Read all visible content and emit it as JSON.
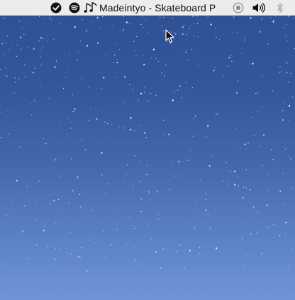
{
  "menubar": {
    "icons": {
      "checkmark": "checkmark-circle-icon",
      "spotify": "spotify-icon",
      "music": "music-note-icon",
      "stop": "stop-circle-icon",
      "volume": "volume-icon",
      "bluetooth": "bluetooth-icon"
    },
    "now_playing": "Madeintyo - Skateboard P"
  },
  "colors": {
    "menubar_bg": "#ececec",
    "sky_top": "#2e4f94",
    "sky_bottom": "#6f95d8"
  }
}
